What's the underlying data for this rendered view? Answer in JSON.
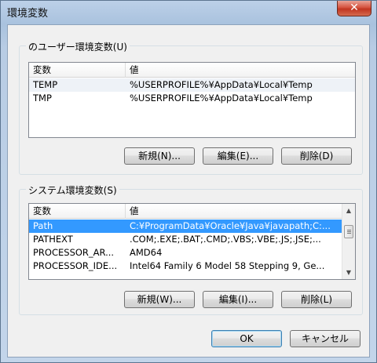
{
  "window": {
    "title": "環境変数",
    "close_label": "✕"
  },
  "user_vars": {
    "legend": "のユーザー環境変数(U)",
    "columns": [
      "変数",
      "値"
    ],
    "rows": [
      {
        "name": "TEMP",
        "value": "%USERPROFILE%¥AppData¥Local¥Temp"
      },
      {
        "name": "TMP",
        "value": "%USERPROFILE%¥AppData¥Local¥Temp"
      }
    ],
    "buttons": {
      "new": "新規(N)...",
      "edit": "編集(E)...",
      "delete": "削除(D)"
    }
  },
  "system_vars": {
    "legend": "システム環境変数(S)",
    "columns": [
      "変数",
      "値"
    ],
    "rows": [
      {
        "name": "Path",
        "value": "C:¥ProgramData¥Oracle¥Java¥javapath;C:..."
      },
      {
        "name": "PATHEXT",
        "value": ".COM;.EXE;.BAT;.CMD;.VBS;.VBE;.JS;.JSE;..."
      },
      {
        "name": "PROCESSOR_AR...",
        "value": "AMD64"
      },
      {
        "name": "PROCESSOR_IDE...",
        "value": "Intel64 Family 6 Model 58 Stepping 9, Ge..."
      }
    ],
    "buttons": {
      "new": "新規(W)...",
      "edit": "編集(I)...",
      "delete": "削除(L)"
    },
    "scroll_up_icon": "▲",
    "scroll_down_icon": "▼"
  },
  "footer": {
    "ok": "OK",
    "cancel": "キャンセル"
  },
  "colors": {
    "selection": "#3399ff",
    "close_button": "#c9442f"
  }
}
